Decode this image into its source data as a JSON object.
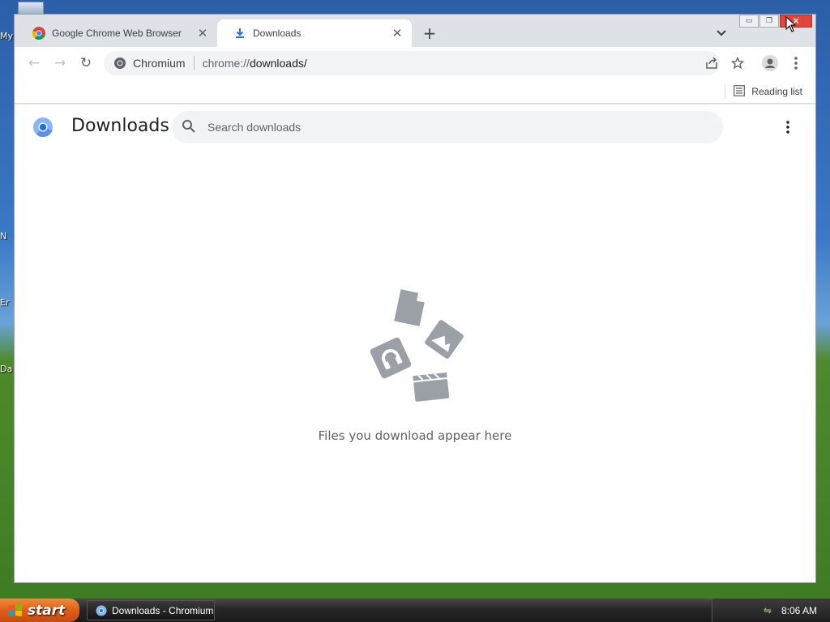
{
  "desktop": {
    "icon_labels": [
      "My",
      "N",
      "Er",
      "Da"
    ]
  },
  "browser": {
    "tabs": [
      {
        "title": "Google Chrome Web Browser",
        "icon": "chrome-logo-icon",
        "active": false
      },
      {
        "title": "Downloads",
        "icon": "download-icon",
        "active": true
      }
    ],
    "new_tab_label": "+",
    "window_controls": {
      "minimize": "▭",
      "restore": "❐",
      "close": "✕"
    },
    "toolbar": {
      "back_icon": "←",
      "forward_icon": "→",
      "reload_icon": "↻",
      "site_chip": "Chromium",
      "url_scheme": "chrome://",
      "url_host": "downloads/"
    },
    "bookmarks_bar": {
      "reading_list": "Reading list"
    }
  },
  "page": {
    "title": "Downloads",
    "search_placeholder": "Search downloads",
    "empty_message": "Files you download appear here"
  },
  "taskbar": {
    "start_label": "start",
    "window_button": "Downloads - Chromium",
    "clock": "8:06 AM"
  },
  "colors": {
    "accent_blue": "#1a73e8",
    "close_red": "#e0443e",
    "empty_art_gray": "#9aa0a6"
  }
}
